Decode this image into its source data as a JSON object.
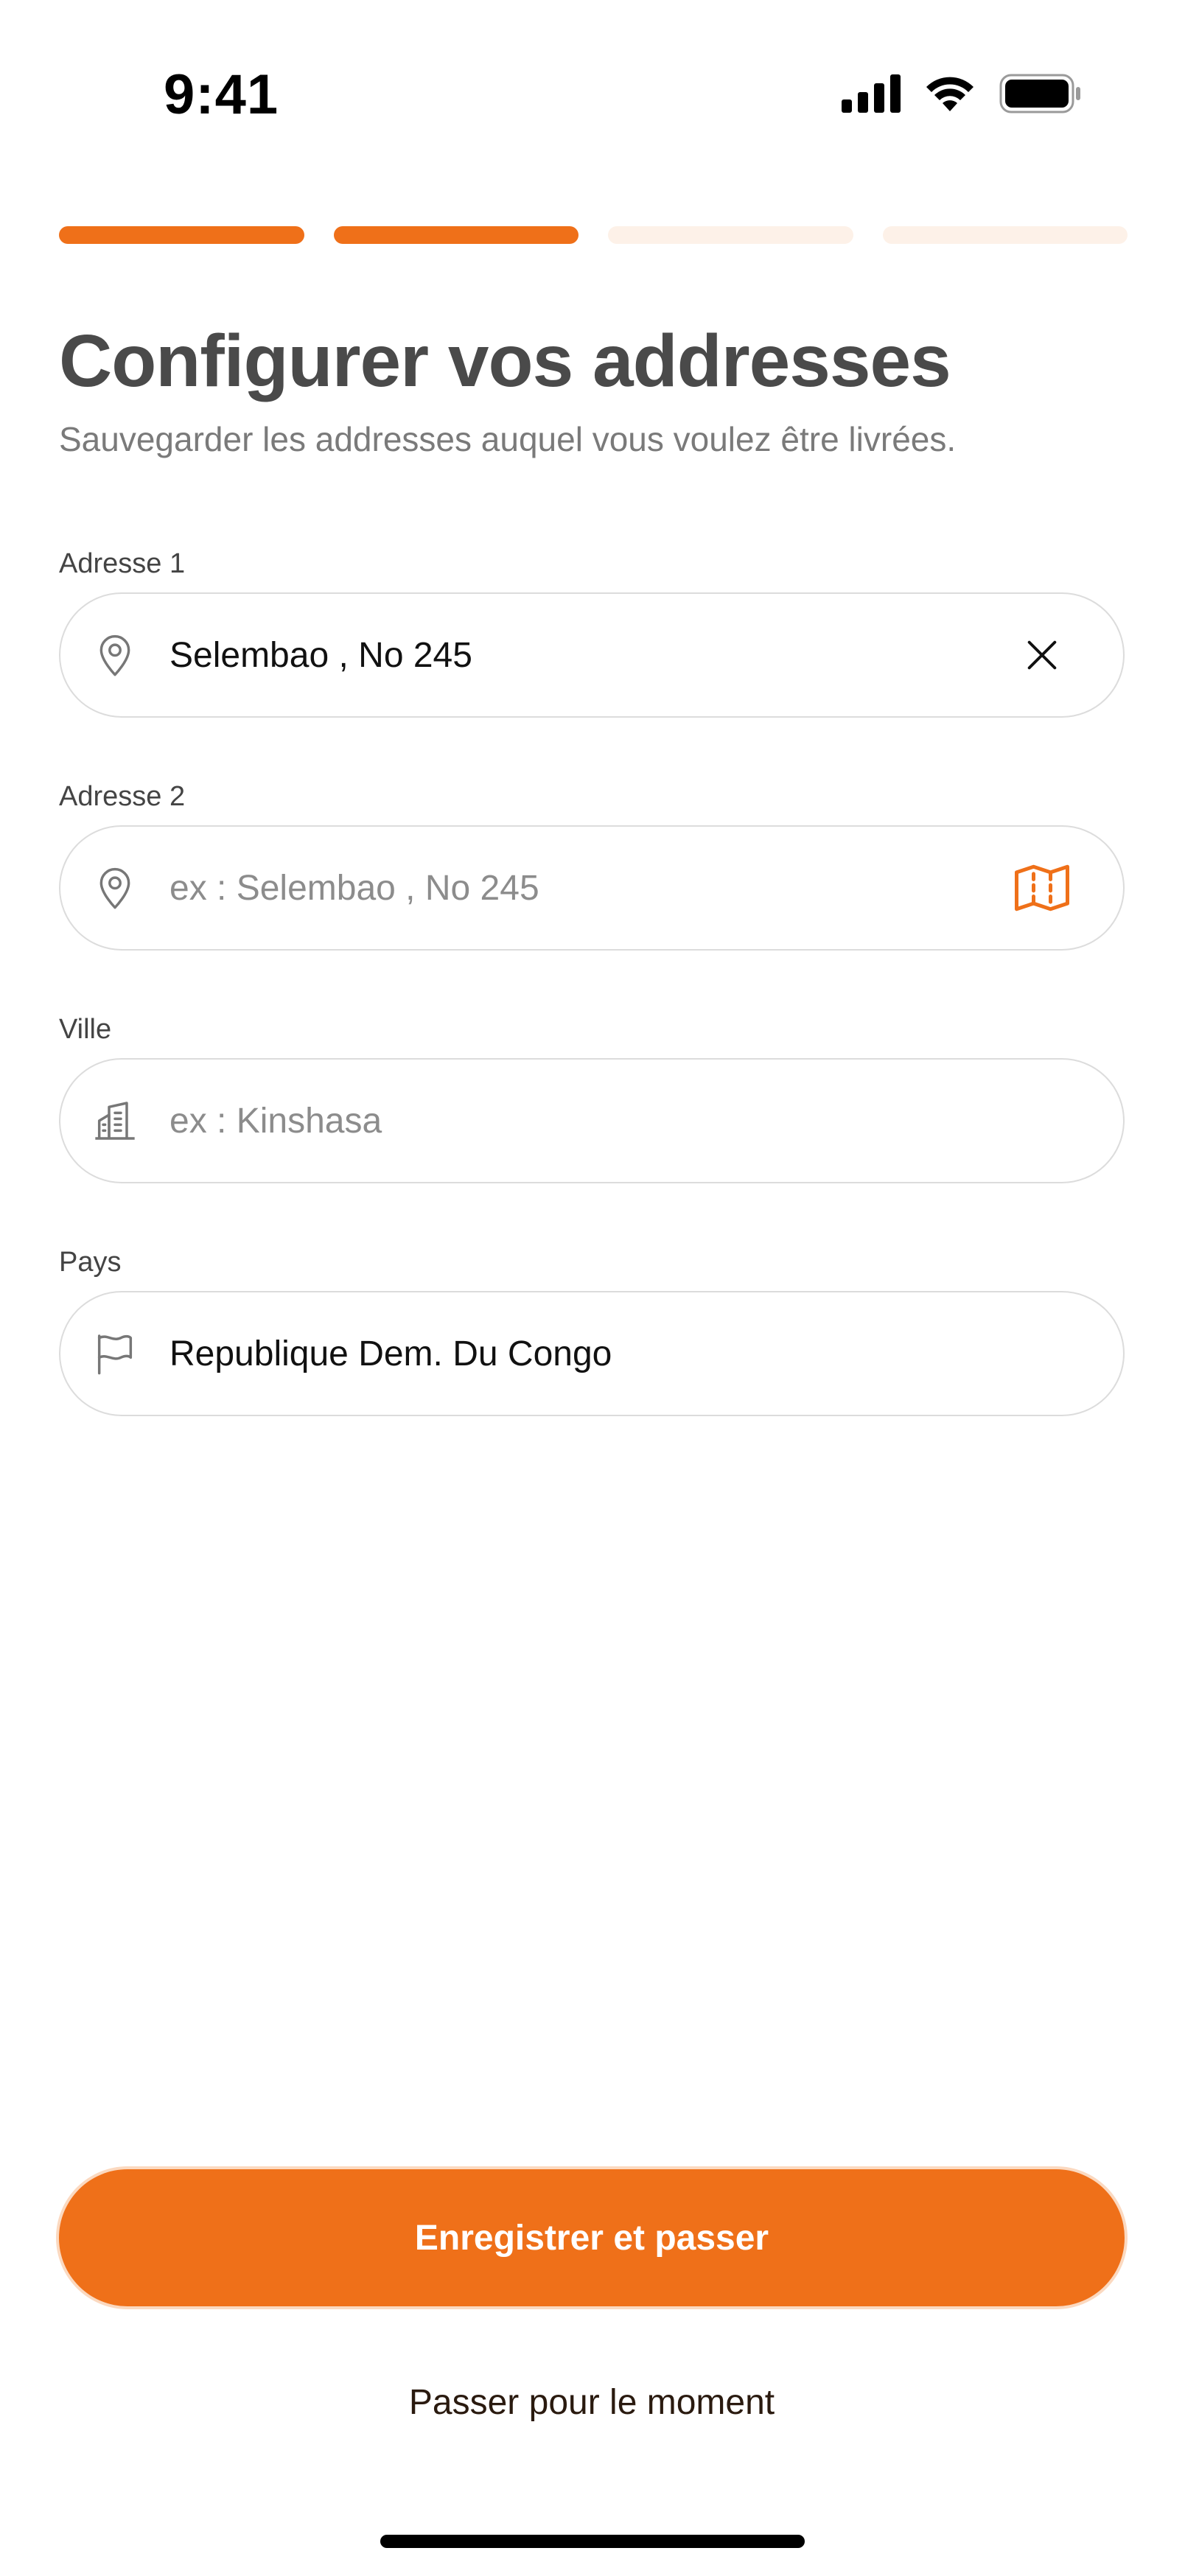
{
  "status_bar": {
    "time": "9:41"
  },
  "progress": {
    "steps": 4,
    "completed": 2,
    "active_color": "#ef7019",
    "inactive_color": "#fdf1e8"
  },
  "header": {
    "title": "Configurer vos addresses",
    "subtitle": "Sauvegarder les addresses auquel vous voulez être livrées."
  },
  "form": {
    "address1": {
      "label": "Adresse 1",
      "value": "Selembao , No 245",
      "icon": "location-pin-icon",
      "trailing_icon": "clear-x-icon"
    },
    "address2": {
      "label": "Adresse 2",
      "placeholder": "ex : Selembao , No 245",
      "icon": "location-pin-icon",
      "trailing_icon": "map-icon"
    },
    "city": {
      "label": "Ville",
      "placeholder": "ex : Kinshasa",
      "icon": "building-icon"
    },
    "country": {
      "label": "Pays",
      "value": "Republique Dem. Du Congo",
      "icon": "flag-icon"
    }
  },
  "actions": {
    "primary_label": "Enregistrer et passer",
    "secondary_label": "Passer pour le moment"
  },
  "colors": {
    "accent": "#ef7019",
    "title": "#4a4a4a",
    "muted": "#7a7a7a"
  }
}
